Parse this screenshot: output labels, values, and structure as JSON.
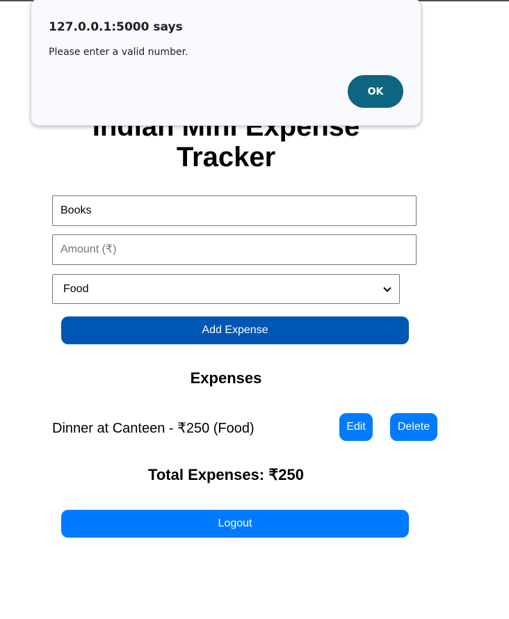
{
  "dialog": {
    "origin": "127.0.0.1:5000 says",
    "message": "Please enter a valid number.",
    "ok_label": "OK"
  },
  "app": {
    "title": "Indian Mini Expense Tracker"
  },
  "form": {
    "description_value": "Books",
    "amount_value": "",
    "amount_placeholder": "Amount (₹)",
    "category_selected": "Food",
    "add_button_label": "Add Expense"
  },
  "expenses": {
    "heading": "Expenses",
    "items": [
      {
        "text": "Dinner at Canteen - ₹250 (Food)",
        "edit_label": "Edit",
        "delete_label": "Delete"
      }
    ]
  },
  "summary": {
    "total_text": "Total Expenses: ₹250"
  },
  "logout": {
    "label": "Logout"
  },
  "colors": {
    "add_button": "#0056b3",
    "action_button": "#007bff",
    "dialog_ok": "#0e6581",
    "dialog_bg": "#f8fafd"
  }
}
